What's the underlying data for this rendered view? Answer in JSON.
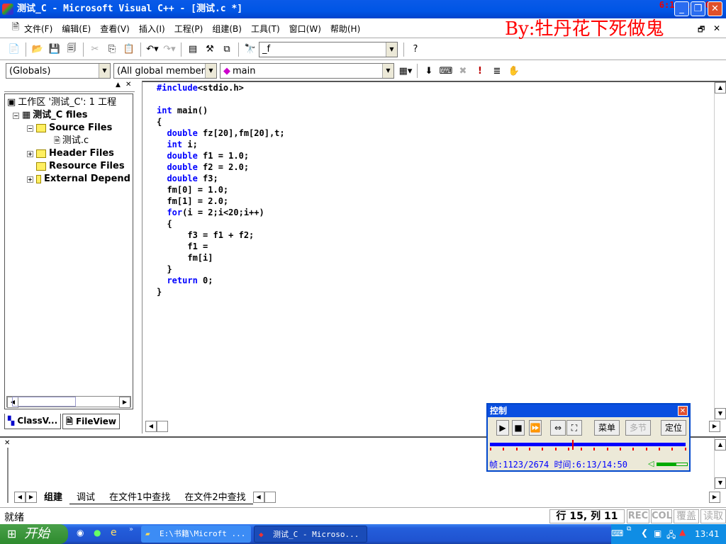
{
  "window": {
    "title": "测试_C - Microsoft Visual C++ - [测试.c *]",
    "time_overlay": "6:13/14:50",
    "watermark": "By:牡丹花下死做鬼"
  },
  "menu": [
    "文件(F)",
    "编辑(E)",
    "查看(V)",
    "插入(I)",
    "工程(P)",
    "组建(B)",
    "工具(T)",
    "窗口(W)",
    "帮助(H)"
  ],
  "toolbar": {
    "find_value": "_f",
    "globals": "(Globals)",
    "members": "(All global members",
    "function": "main"
  },
  "workspace": {
    "root": "工作区 '测试_C': 1 工程",
    "project": "测试_C files",
    "items": [
      "Source Files",
      "测试.c",
      "Header Files",
      "Resource Files",
      "External Depend"
    ],
    "tabs": [
      "ClassV...",
      "FileView"
    ]
  },
  "editor": {
    "lines": [
      "#include<stdio.h>",
      "",
      "int main()",
      "{",
      "  double fz[20],fm[20],t;",
      "  int i;",
      "  double f1 = 1.0;",
      "  double f2 = 2.0;",
      "  double f3;",
      "  fm[0] = 1.0;",
      "  fm[1] = 2.0;",
      "  for(i = 2;i<20;i++)",
      "  {",
      "      f3 = f1 + f2;",
      "      f1 =",
      "      fm[i]",
      "  }",
      "  return 0;",
      "}"
    ]
  },
  "output": {
    "tabs": [
      "组建",
      "调试",
      "在文件1中查找",
      "在文件2中查找"
    ]
  },
  "status": {
    "text": "就绪",
    "position": "行 15, 列 11",
    "rec": "REC",
    "col": "COL",
    "ovr": "覆盖",
    "read": "读取"
  },
  "taskbar": {
    "start": "开始",
    "tasks": [
      "E:\\书籍\\Microft ...",
      "测试_C - Microso..."
    ],
    "clock": "13:41"
  },
  "control": {
    "title": "控制",
    "buttons": [
      "菜单",
      "多节",
      "定位"
    ],
    "frame": "帧:1123/2674",
    "time": "时间:6:13/14:50",
    "progress": 0.42,
    "volume": 0.65,
    "accent": "#0000ff"
  }
}
